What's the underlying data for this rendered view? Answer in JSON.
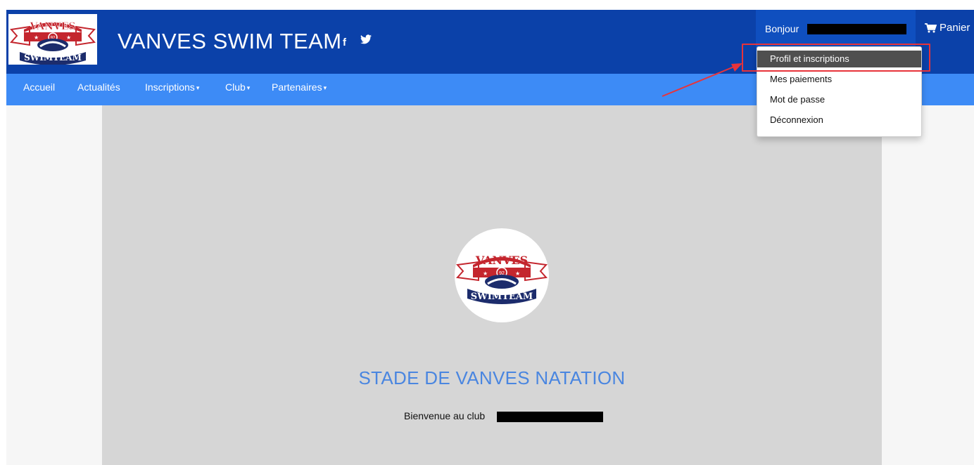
{
  "header": {
    "site_title": "VANVES SWIM TEAM",
    "social": {
      "facebook": "f",
      "twitter": "🐦"
    },
    "greeting": "Bonjour",
    "cart_label": "Panier",
    "colors": {
      "header_bg": "#0b41a9",
      "navbar_bg": "#3d8bf6",
      "accent_text": "#4a86e0"
    }
  },
  "logo": {
    "top_text": "VANVES",
    "number": "92",
    "bottom_text": "SWIMTEAM"
  },
  "nav": {
    "items": [
      {
        "label": "Accueil",
        "dropdown": false
      },
      {
        "label": "Actualités",
        "dropdown": false
      },
      {
        "label": "Inscriptions",
        "dropdown": true
      },
      {
        "label": "Club",
        "dropdown": true
      },
      {
        "label": "Partenaires",
        "dropdown": true
      }
    ],
    "caret": "▾"
  },
  "user_menu": {
    "items": [
      {
        "label": "Profil et inscriptions",
        "active": true
      },
      {
        "label": "Mes paiements",
        "active": false
      },
      {
        "label": "Mot de passe",
        "active": false
      },
      {
        "label": "Déconnexion",
        "active": false
      }
    ]
  },
  "main": {
    "heading": "STADE DE VANVES NATATION",
    "welcome": "Bienvenue au club"
  }
}
